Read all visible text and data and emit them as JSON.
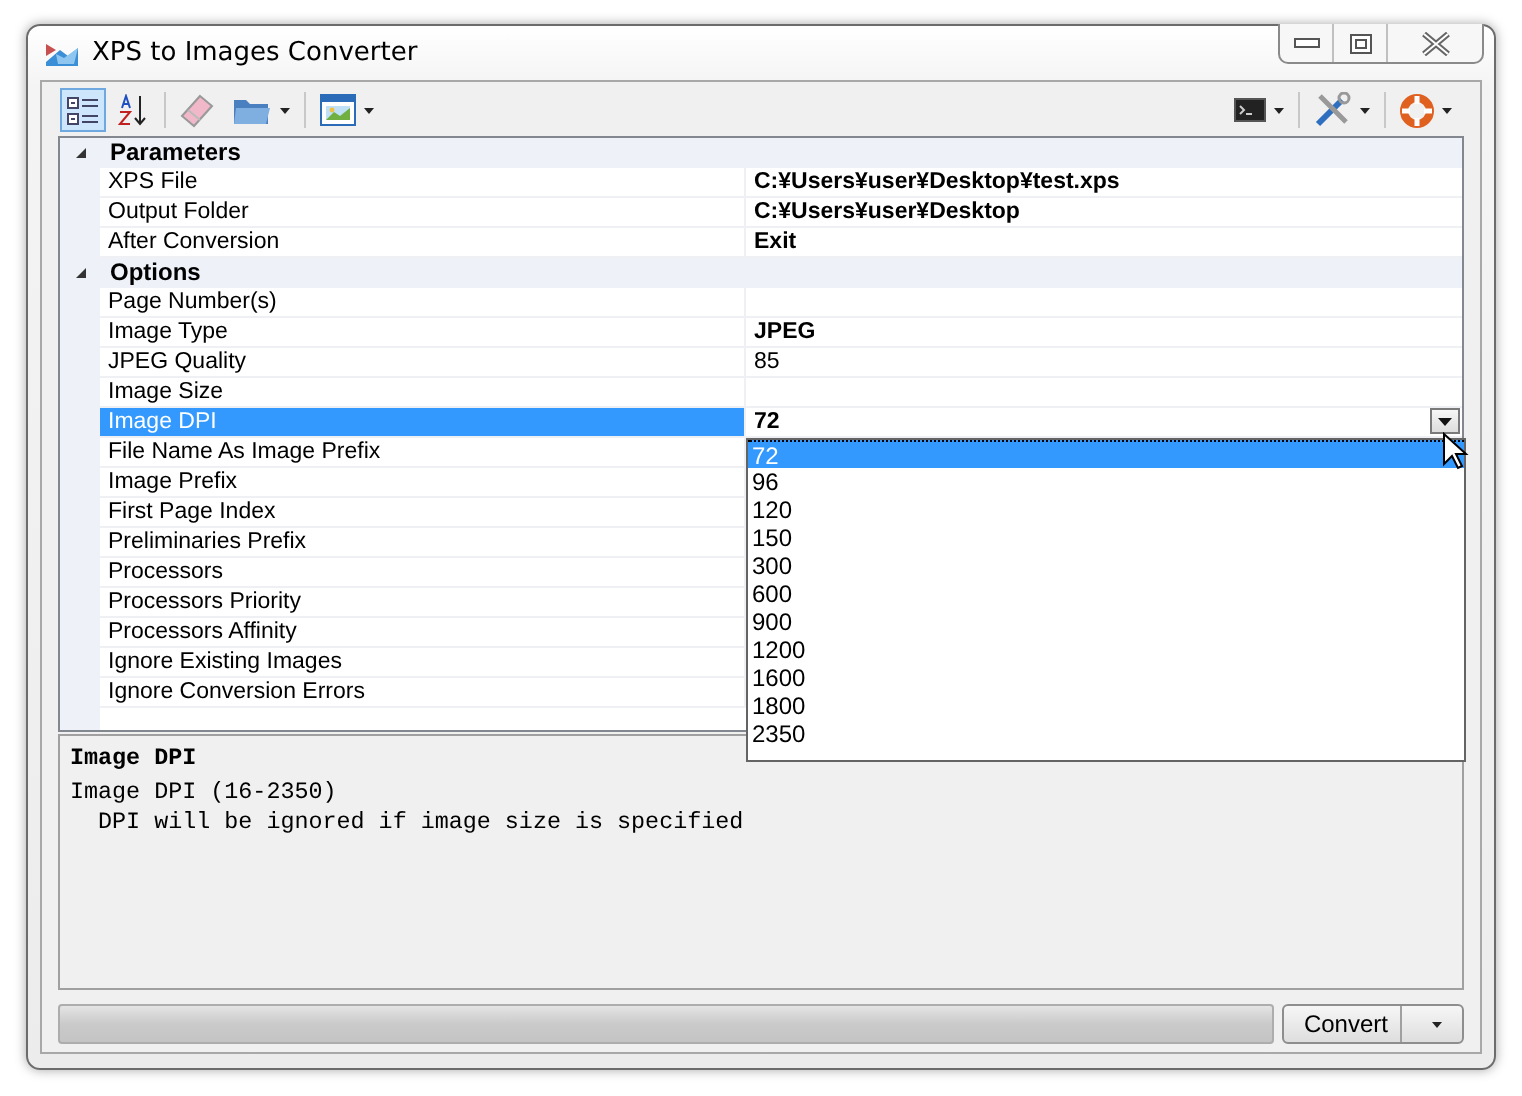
{
  "window": {
    "title": "XPS to Images Converter"
  },
  "toolbar": {
    "view_buttons": [
      {
        "kind": "categorized",
        "selected": true
      },
      {
        "kind": "alphabetical",
        "selected": false
      }
    ]
  },
  "property_grid": {
    "categories": [
      {
        "name": "Parameters",
        "expanded": true,
        "properties": [
          {
            "name": "XPS File",
            "value": "C:¥Users¥user¥Desktop¥test.xps",
            "modified": true,
            "selected": false
          },
          {
            "name": "Output Folder",
            "value": "C:¥Users¥user¥Desktop",
            "modified": true,
            "selected": false
          },
          {
            "name": "After Conversion",
            "value": "Exit",
            "modified": true,
            "selected": false
          }
        ]
      },
      {
        "name": "Options",
        "expanded": true,
        "properties": [
          {
            "name": "Page Number(s)",
            "selected": false
          },
          {
            "name": "Image Type",
            "value": "JPEG",
            "modified": true,
            "selected": false
          },
          {
            "name": "JPEG Quality",
            "value": "85",
            "modified": false,
            "selected": false
          },
          {
            "name": "Image Size",
            "selected": false
          },
          {
            "name": "Image DPI",
            "value": "72",
            "modified": true,
            "selected": true,
            "dropdown_open": true
          },
          {
            "name": "File Name As Image Prefix",
            "selected": false
          },
          {
            "name": "Image Prefix",
            "selected": false
          },
          {
            "name": "First Page Index",
            "selected": false
          },
          {
            "name": "Preliminaries Prefix",
            "selected": false
          },
          {
            "name": "Processors",
            "selected": false
          },
          {
            "name": "Processors Priority",
            "selected": false
          },
          {
            "name": "Processors Affinity",
            "selected": false
          },
          {
            "name": "Ignore Existing Images",
            "selected": false
          },
          {
            "name": "Ignore Conversion Errors",
            "selected": false
          }
        ]
      }
    ],
    "dropdown_options": [
      {
        "label": "72",
        "selected": true
      },
      {
        "label": "96",
        "selected": false
      },
      {
        "label": "120",
        "selected": false
      },
      {
        "label": "150",
        "selected": false
      },
      {
        "label": "300",
        "selected": false
      },
      {
        "label": "600",
        "selected": false
      },
      {
        "label": "900",
        "selected": false
      },
      {
        "label": "1200",
        "selected": false
      },
      {
        "label": "1600",
        "selected": false
      },
      {
        "label": "1800",
        "selected": false
      },
      {
        "label": "2350",
        "selected": false
      }
    ]
  },
  "description": {
    "title": "Image DPI",
    "lines": [
      "Image DPI (16-2350)",
      "  DPI will be ignored if image size is specified"
    ]
  },
  "bottom_bar": {
    "progress": {
      "level": 0
    },
    "convert_button": "Convert"
  }
}
